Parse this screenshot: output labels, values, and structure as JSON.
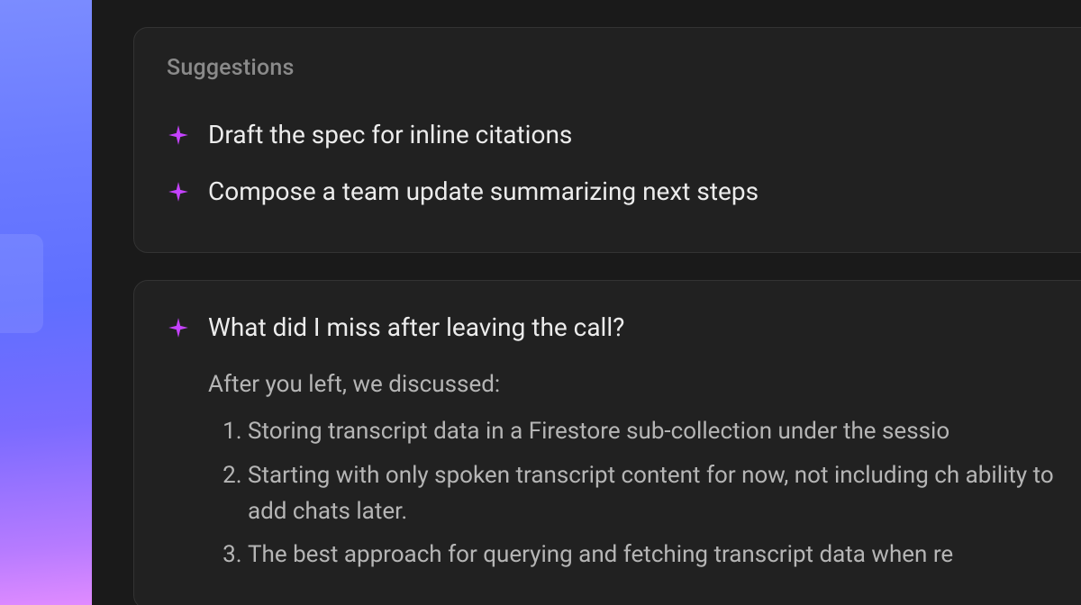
{
  "colors": {
    "accent": "#c542ff",
    "panel_bg": "#212121",
    "panel_border": "#333333",
    "heading_muted": "#8a8a8a",
    "body_muted": "#b5b5b5",
    "text_primary": "#ececec"
  },
  "suggestions": {
    "heading": "Suggestions",
    "items": [
      {
        "icon": "sparkle-icon",
        "label": "Draft the spec for inline citations"
      },
      {
        "icon": "sparkle-icon",
        "label": "Compose a team update summarizing next steps"
      }
    ]
  },
  "qa": {
    "icon": "sparkle-icon",
    "question": "What did I miss after leaving the call?",
    "lead": "After you left, we discussed:",
    "points": [
      "Storing transcript data in a Firestore sub-collection under the sessio",
      "Starting with only spoken transcript content for now, not including ch ability to add chats later.",
      "The best approach for querying and fetching transcript data when re"
    ]
  }
}
